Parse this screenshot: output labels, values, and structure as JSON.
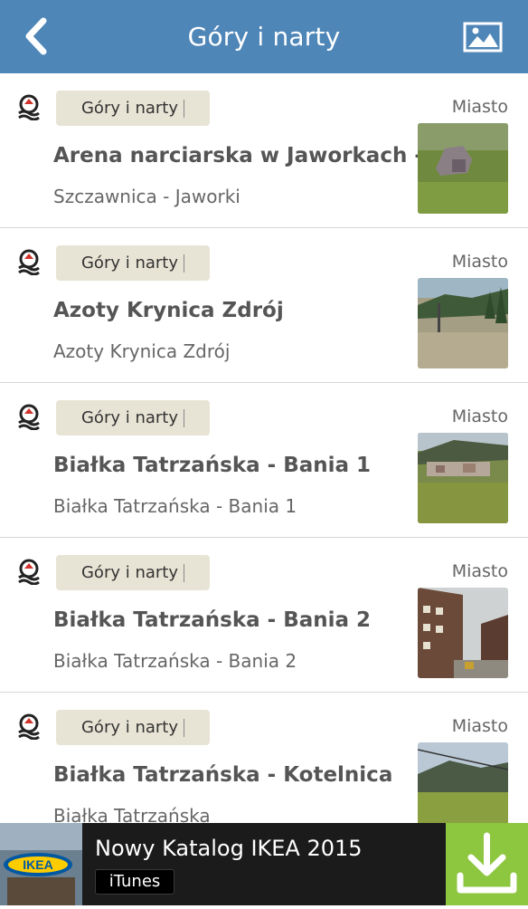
{
  "header": {
    "title": "Góry i narty",
    "back_icon": "chevron-left-icon",
    "gallery_icon": "image-icon"
  },
  "items": [
    {
      "category": "Góry i narty",
      "name": "Arena narciarska w Jaworkach -",
      "location": "Szczawnica - Jaworki",
      "city_label": "Miasto"
    },
    {
      "category": "Góry i narty",
      "name": "Azoty Krynica Zdrój",
      "location": "Azoty Krynica Zdrój",
      "city_label": "Miasto"
    },
    {
      "category": "Góry i narty",
      "name": "Białka Tatrzańska - Bania 1",
      "location": "Białka Tatrzańska - Bania 1",
      "city_label": "Miasto"
    },
    {
      "category": "Góry i narty",
      "name": "Białka Tatrzańska - Bania 2",
      "location": "Białka Tatrzańska - Bania 2",
      "city_label": "Miasto"
    },
    {
      "category": "Góry i narty",
      "name": "Białka Tatrzańska - Kotelnica",
      "location": "Białka Tatrzańska",
      "city_label": "Miasto"
    }
  ],
  "ad": {
    "title": "Nowy Katalog IKEA 2015",
    "store": "iTunes",
    "brand_logo_text": "IKEA",
    "download_icon": "download-icon",
    "accent_color": "#8dc63f"
  },
  "colors": {
    "header_bg": "#4f86b8",
    "badge_bg": "#e8e4d5"
  }
}
